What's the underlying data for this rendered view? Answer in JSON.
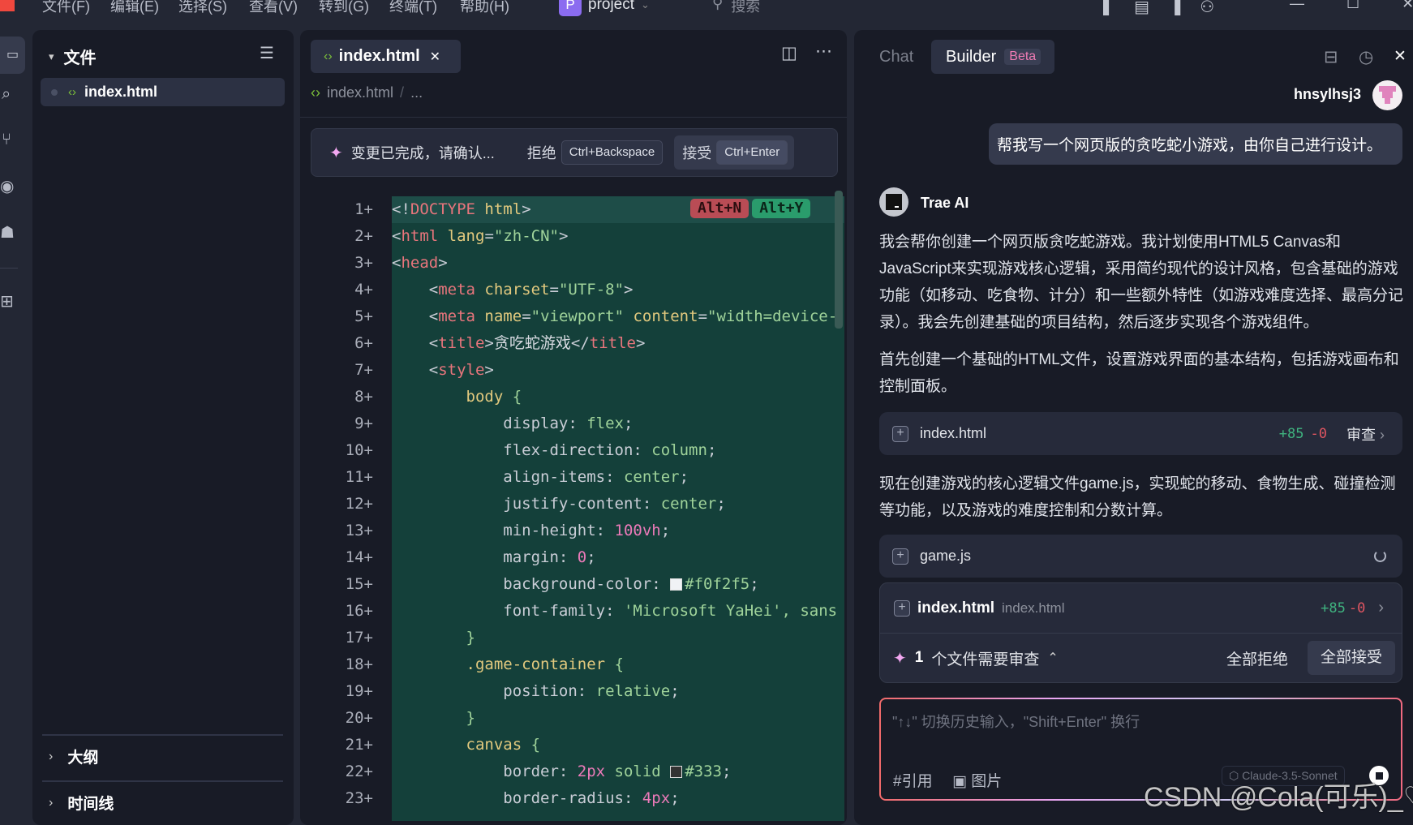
{
  "menu": [
    "文件(F)",
    "编辑(E)",
    "选择(S)",
    "查看(V)",
    "转到(G)",
    "终端(T)",
    "帮助(H)"
  ],
  "project": {
    "badge": "P",
    "name": "project"
  },
  "search_placeholder": "搜索",
  "sidebar": {
    "title": "文件",
    "files": [
      {
        "name": "index.html"
      }
    ],
    "sections": [
      "大纲",
      "时间线"
    ]
  },
  "editor": {
    "tab": "index.html",
    "breadcrumb": [
      "index.html",
      "..."
    ],
    "notice": {
      "text": "变更已完成，请确认...",
      "reject": "拒绝",
      "reject_key": "Ctrl+Backspace",
      "accept": "接受",
      "accept_key": "Ctrl+Enter"
    },
    "inline_keys": {
      "reject": "Alt+N",
      "accept": "Alt+Y"
    },
    "lines": [
      [
        [
          "pun",
          "<!"
        ],
        [
          "tag",
          "DOCTYPE"
        ],
        [
          "pun",
          " "
        ],
        [
          "attr",
          "html"
        ],
        [
          "pun",
          ">"
        ]
      ],
      [
        [
          "pun",
          "<"
        ],
        [
          "tag",
          "html"
        ],
        [
          "pun",
          " "
        ],
        [
          "attr",
          "lang"
        ],
        [
          "pun",
          "="
        ],
        [
          "str",
          "\"zh-CN\""
        ],
        [
          "pun",
          ">"
        ]
      ],
      [
        [
          "pun",
          "<"
        ],
        [
          "tag",
          "head"
        ],
        [
          "pun",
          ">"
        ]
      ],
      [
        [
          "pun",
          "    <"
        ],
        [
          "tag",
          "meta"
        ],
        [
          "pun",
          " "
        ],
        [
          "attr",
          "charset"
        ],
        [
          "pun",
          "="
        ],
        [
          "str",
          "\"UTF-8\""
        ],
        [
          "pun",
          ">"
        ]
      ],
      [
        [
          "pun",
          "    <"
        ],
        [
          "tag",
          "meta"
        ],
        [
          "pun",
          " "
        ],
        [
          "attr",
          "name"
        ],
        [
          "pun",
          "="
        ],
        [
          "str",
          "\"viewport\""
        ],
        [
          "pun",
          " "
        ],
        [
          "attr",
          "content"
        ],
        [
          "pun",
          "="
        ],
        [
          "str",
          "\"width=device-"
        ]
      ],
      [
        [
          "pun",
          "    <"
        ],
        [
          "tag",
          "title"
        ],
        [
          "pun",
          ">"
        ],
        [
          "txt",
          "贪吃蛇游戏"
        ],
        [
          "pun",
          "</"
        ],
        [
          "tag",
          "title"
        ],
        [
          "pun",
          ">"
        ]
      ],
      [
        [
          "pun",
          "    <"
        ],
        [
          "tag",
          "style"
        ],
        [
          "pun",
          ">"
        ]
      ],
      [
        [
          "pun",
          "        "
        ],
        [
          "sel",
          "body"
        ],
        [
          "pun",
          " "
        ],
        [
          "val",
          "{"
        ]
      ],
      [
        [
          "prop",
          "            display: "
        ],
        [
          "val",
          "flex"
        ],
        [
          "pun",
          ";"
        ]
      ],
      [
        [
          "prop",
          "            flex-direction: "
        ],
        [
          "val",
          "column"
        ],
        [
          "pun",
          ";"
        ]
      ],
      [
        [
          "prop",
          "            align-items: "
        ],
        [
          "val",
          "center"
        ],
        [
          "pun",
          ";"
        ]
      ],
      [
        [
          "prop",
          "            justify-content: "
        ],
        [
          "val",
          "center"
        ],
        [
          "pun",
          ";"
        ]
      ],
      [
        [
          "prop",
          "            min-height: "
        ],
        [
          "num",
          "100vh"
        ],
        [
          "pun",
          ";"
        ]
      ],
      [
        [
          "prop",
          "            margin: "
        ],
        [
          "num",
          "0"
        ],
        [
          "pun",
          ";"
        ]
      ],
      [
        [
          "prop",
          "            background-color: "
        ],
        [
          "swatch",
          "#f0f2f5"
        ],
        [
          "val",
          "#f0f2f5"
        ],
        [
          "pun",
          ";"
        ]
      ],
      [
        [
          "prop",
          "            font-family: "
        ],
        [
          "val",
          "'Microsoft YaHei', sans"
        ]
      ],
      [
        [
          "pun",
          "        "
        ],
        [
          "val",
          "}"
        ]
      ],
      [
        [
          "pun",
          "        "
        ],
        [
          "sel",
          ".game-container"
        ],
        [
          "pun",
          " "
        ],
        [
          "val",
          "{"
        ]
      ],
      [
        [
          "prop",
          "            position: "
        ],
        [
          "val",
          "relative"
        ],
        [
          "pun",
          ";"
        ]
      ],
      [
        [
          "pun",
          "        "
        ],
        [
          "val",
          "}"
        ]
      ],
      [
        [
          "pun",
          "        "
        ],
        [
          "sel",
          "canvas"
        ],
        [
          "pun",
          " "
        ],
        [
          "val",
          "{"
        ]
      ],
      [
        [
          "prop",
          "            border: "
        ],
        [
          "num",
          "2px"
        ],
        [
          "val",
          " solid "
        ],
        [
          "swatch",
          "#333333"
        ],
        [
          "val",
          "#333"
        ],
        [
          "pun",
          ";"
        ]
      ],
      [
        [
          "prop",
          "            border-radius: "
        ],
        [
          "num",
          "4px"
        ],
        [
          "pun",
          ";"
        ]
      ]
    ]
  },
  "chat": {
    "tabs": [
      "Chat",
      "Builder"
    ],
    "beta": "Beta",
    "user": "hnsylhsj3",
    "user_message": "帮我写一个网页版的贪吃蛇小游戏，由你自己进行设计。",
    "assistant": "Trae AI",
    "para1": "我会帮你创建一个网页版贪吃蛇游戏。我计划使用HTML5 Canvas和JavaScript来实现游戏核心逻辑，采用简约现代的设计风格，包含基础的游戏功能（如移动、吃食物、计分）和一些额外特性（如游戏难度选择、最高分记录）。我会先创建基础的项目结构，然后逐步实现各个游戏组件。",
    "para2": "首先创建一个基础的HTML文件，设置游戏界面的基本结构，包括游戏画布和控制面板。",
    "file1": {
      "name": "index.html",
      "added": "+85",
      "removed": "-0",
      "action": "审查"
    },
    "para3": "现在创建游戏的核心逻辑文件game.js，实现蛇的移动、食物生成、碰撞检测等功能，以及游戏的难度控制和分数计算。",
    "file2": {
      "name": "game.js"
    },
    "review": {
      "file": "index.html",
      "path": "index.html",
      "added": "+85",
      "removed": "-0",
      "count": "1",
      "label": "个文件需要审查",
      "reject_all": "全部拒绝",
      "accept_all": "全部接受"
    },
    "input_placeholder": "\"↑↓\" 切换历史输入，\"Shift+Enter\" 换行",
    "ref": "#引用",
    "image": "图片",
    "model": "Claude-3.5-Sonnet"
  },
  "watermark": "CSDN @Cola(可乐)_♡",
  "colors": {
    "accent": "#8b6cf0",
    "added": "#3fb27f",
    "removed": "#e05561",
    "diff_bg": "#14403a"
  }
}
